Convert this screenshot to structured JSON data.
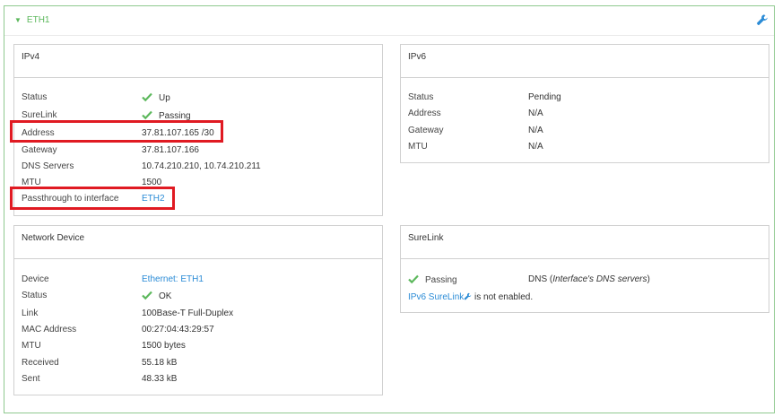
{
  "section": {
    "title": "ETH1",
    "colors": {
      "accent": "#5cb85c",
      "link": "#2a8bd6",
      "highlight": "#e01a22",
      "border": "#8fc98f"
    }
  },
  "ipv4": {
    "title": "IPv4",
    "status_label": "Status",
    "status_value": "Up",
    "surelink_label": "SureLink",
    "surelink_value": "Passing",
    "address_label": "Address",
    "address_value": "37.81.107.165 /30",
    "gateway_label": "Gateway",
    "gateway_value": "37.81.107.166",
    "dns_label": "DNS Servers",
    "dns_value": "10.74.210.210, 10.74.210.211",
    "mtu_label": "MTU",
    "mtu_value": "1500",
    "passthrough_label": "Passthrough to interface",
    "passthrough_value": "ETH2"
  },
  "ipv6": {
    "title": "IPv6",
    "status_label": "Status",
    "status_value": "Pending",
    "address_label": "Address",
    "address_value": "N/A",
    "gateway_label": "Gateway",
    "gateway_value": "N/A",
    "mtu_label": "MTU",
    "mtu_value": "N/A"
  },
  "network_device": {
    "title": "Network Device",
    "device_label": "Device",
    "device_value": "Ethernet: ETH1",
    "status_label": "Status",
    "status_value": "OK",
    "link_label": "Link",
    "link_value": "100Base-T Full-Duplex",
    "mac_label": "MAC Address",
    "mac_value": "00:27:04:43:29:57",
    "mtu_label": "MTU",
    "mtu_value": "1500 bytes",
    "received_label": "Received",
    "received_value": "55.18 kB",
    "sent_label": "Sent",
    "sent_value": "48.33 kB"
  },
  "surelink": {
    "title": "SureLink",
    "passing_label": "Passing",
    "dns_prefix": "DNS (",
    "dns_detail": "Interface's DNS servers",
    "dns_suffix": ")",
    "ipv6_link": "IPv6 SureLink",
    "ipv6_status": " is not enabled."
  },
  "icons": {
    "collapse": "triangle-down-icon",
    "configure": "wrench-icon",
    "ok": "check-icon"
  }
}
